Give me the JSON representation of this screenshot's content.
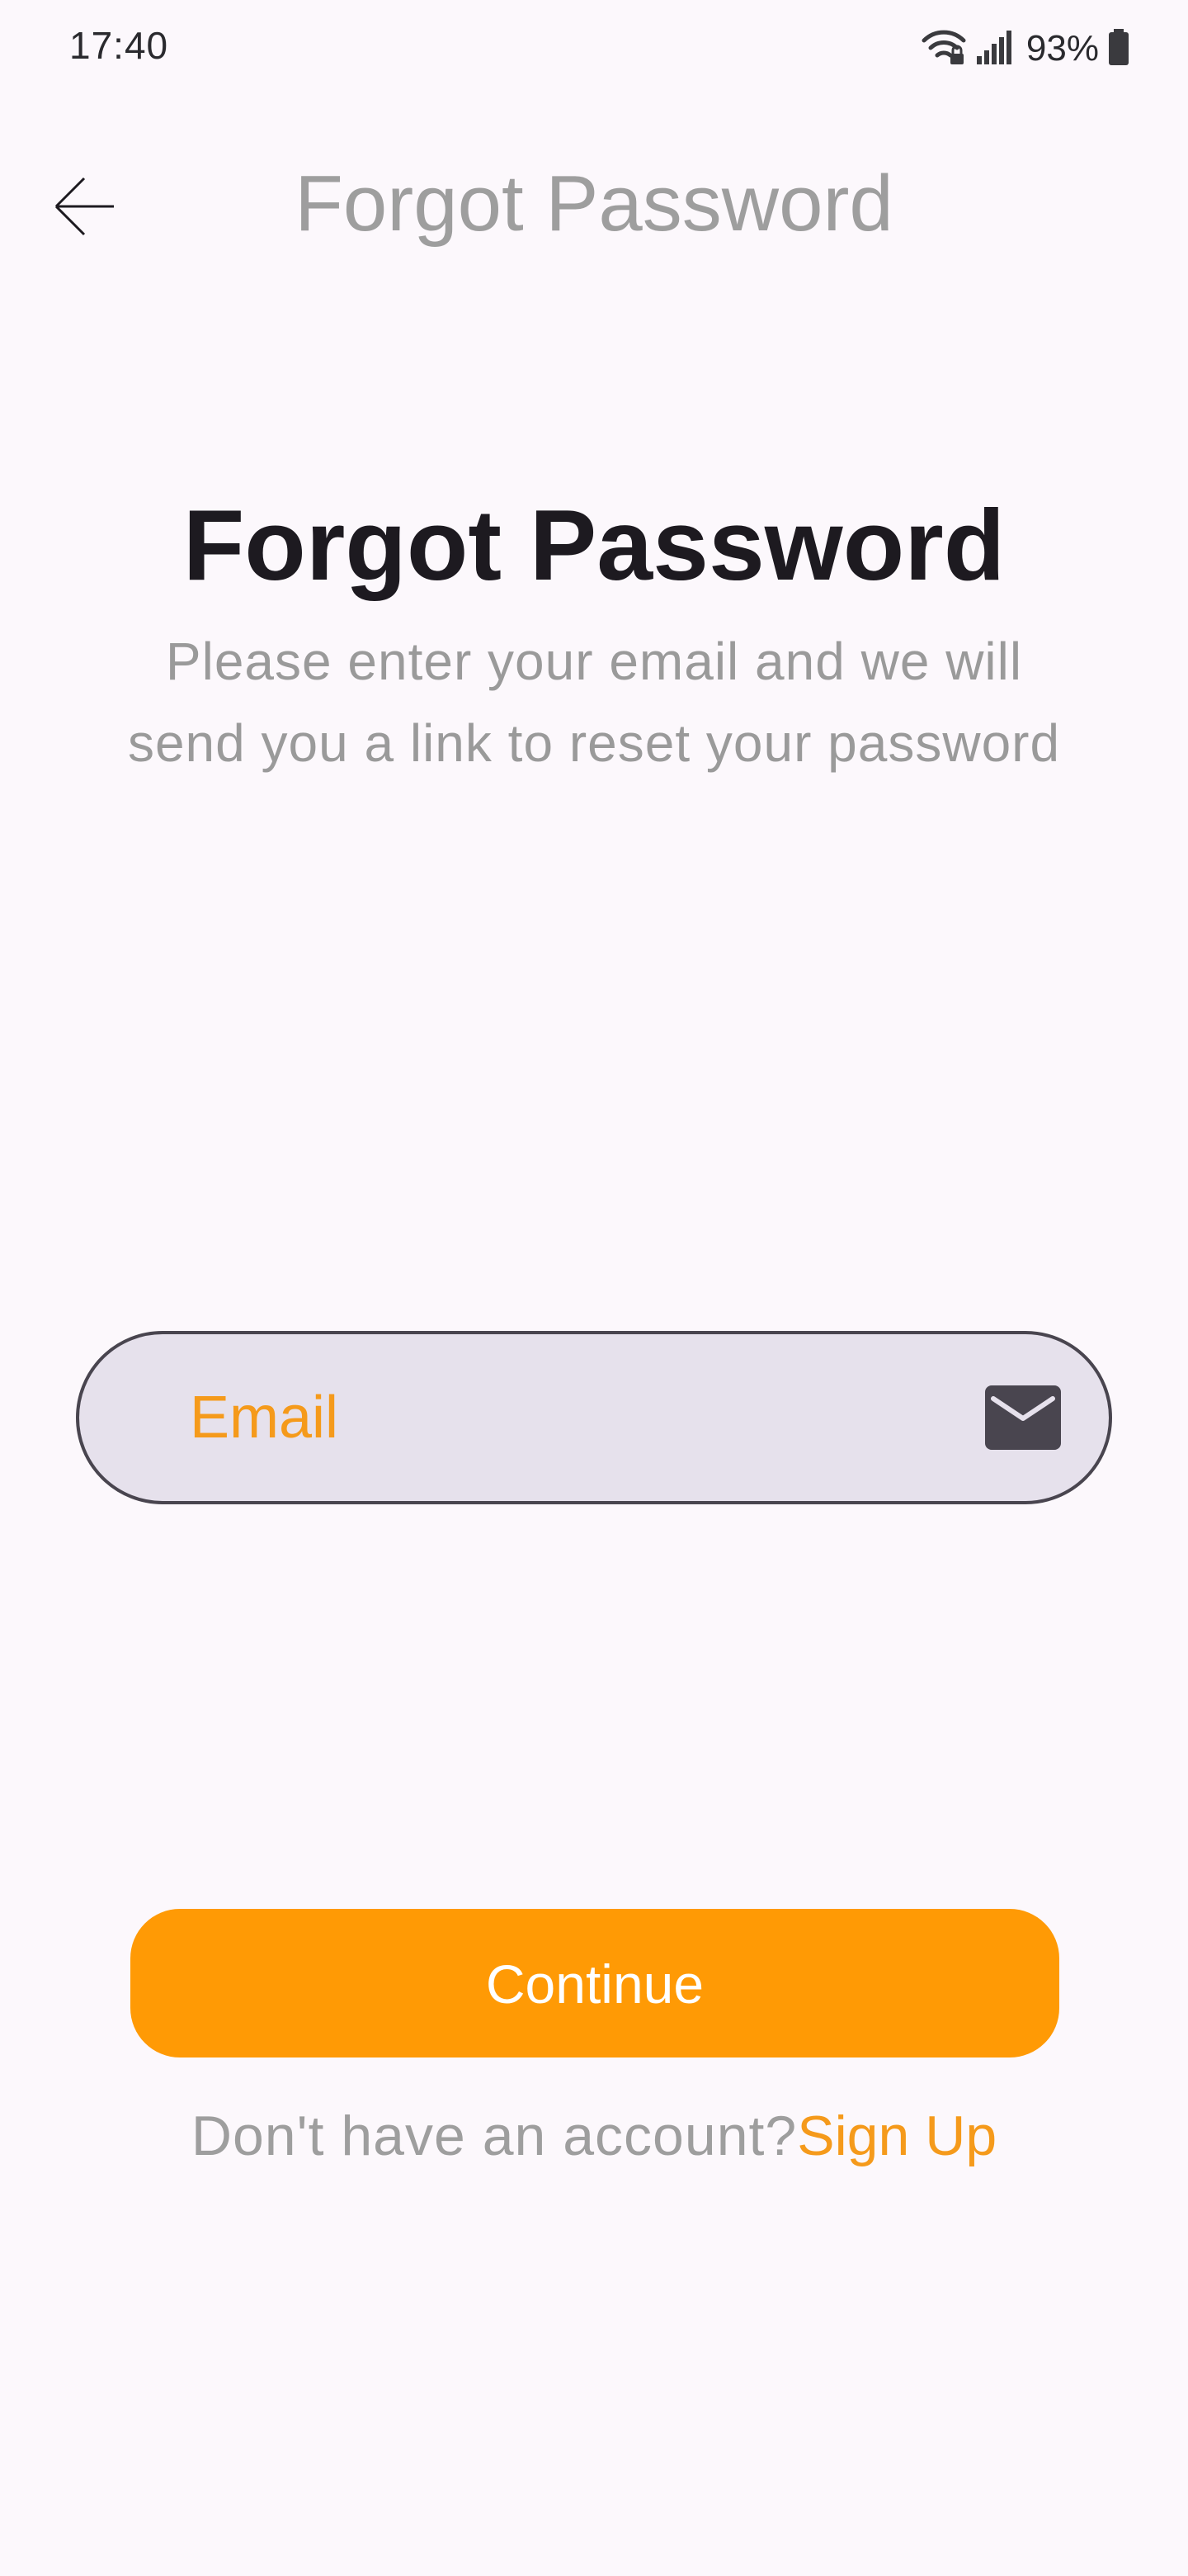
{
  "status_bar": {
    "time": "17:40",
    "battery": "93%"
  },
  "app_bar": {
    "title": "Forgot Password"
  },
  "hero": {
    "title": "Forgot Password",
    "subtitle": "Please enter your email and we will send you a link to reset your password"
  },
  "form": {
    "email_placeholder": "Email"
  },
  "actions": {
    "continue_label": "Continue",
    "signup_prompt": "Don't have an account?",
    "signup_link": "Sign Up"
  },
  "colors": {
    "accent": "#ff9a05",
    "link": "#f59a1b",
    "background": "#fcf8fc",
    "field_fill": "#e6e1ec",
    "field_border": "#49454f"
  },
  "icons": {
    "back": "arrow-left-icon",
    "email": "mail-icon",
    "wifi": "wifi-lock-icon",
    "signal": "signal-icon",
    "battery": "battery-icon"
  }
}
